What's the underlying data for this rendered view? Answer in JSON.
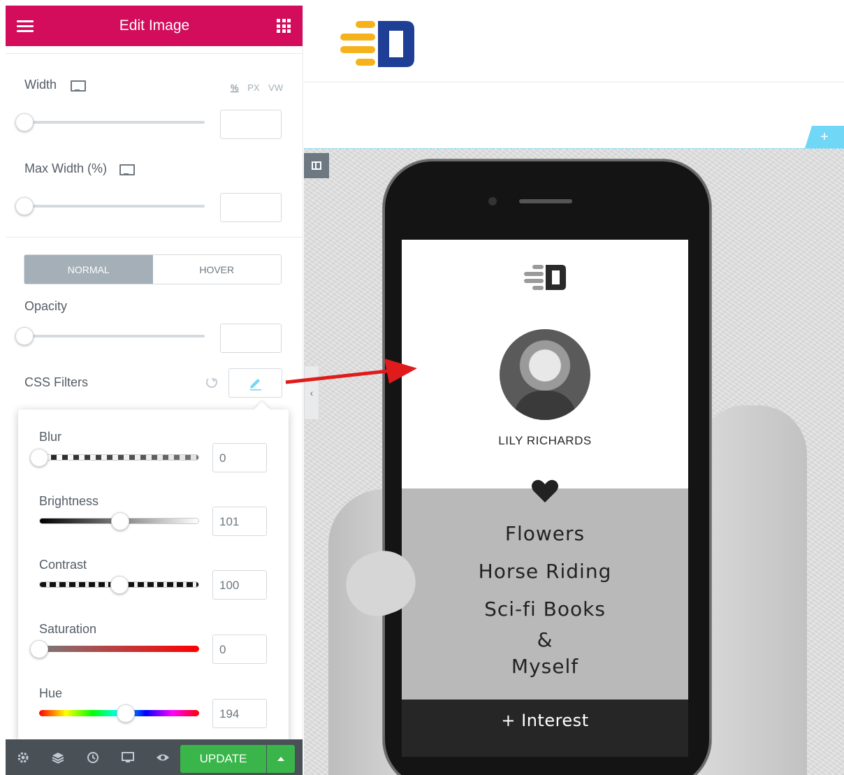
{
  "panel": {
    "title": "Edit Image",
    "width_label": "Width",
    "units": [
      "%",
      "PX",
      "VW"
    ],
    "width_value": "",
    "max_width_label": "Max Width (%)",
    "max_width_value": "",
    "tabs": [
      {
        "label": "NORMAL",
        "active": true
      },
      {
        "label": "HOVER",
        "active": false
      }
    ],
    "opacity_label": "Opacity",
    "opacity_value": "",
    "css_filters_label": "CSS Filters"
  },
  "filters": {
    "blur": {
      "label": "Blur",
      "value": "0",
      "fraction": 0.0
    },
    "brightness": {
      "label": "Brightness",
      "value": "101",
      "fraction": 0.505
    },
    "contrast": {
      "label": "Contrast",
      "value": "100",
      "fraction": 0.5
    },
    "saturation": {
      "label": "Saturation",
      "value": "0",
      "fraction": 0.0
    },
    "hue": {
      "label": "Hue",
      "value": "194",
      "fraction": 0.54
    }
  },
  "footer": {
    "icons": [
      "gear-icon",
      "layers-icon",
      "history-icon",
      "responsive-icon",
      "eye-icon"
    ],
    "update_label": "UPDATE"
  },
  "preview": {
    "add_label": "+",
    "profile_name": "LILY RICHARDS",
    "interests": [
      "Flowers",
      "Horse Riding",
      "Sci-fi Books",
      "&",
      "Myself"
    ],
    "interest_button": "+ Interest"
  },
  "colors": {
    "brand": "#d30c5c",
    "update": "#39b54a",
    "logo_yellow": "#f6b21b",
    "logo_blue": "#1f3f97"
  }
}
